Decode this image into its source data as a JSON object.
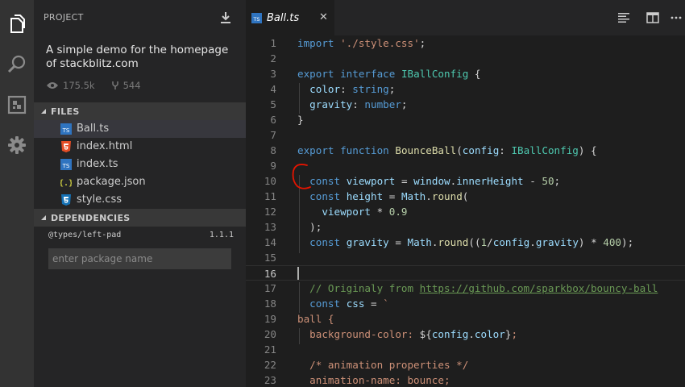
{
  "sidebar": {
    "title": "PROJECT",
    "description": "A simple demo for the homepage of stackblitz.com",
    "views": "175.5k",
    "forks": "544",
    "files_header": "FILES",
    "files": [
      {
        "name": "Ball.ts",
        "icon": "typescript-file-icon"
      },
      {
        "name": "index.html",
        "icon": "html5-file-icon"
      },
      {
        "name": "index.ts",
        "icon": "typescript-file-icon"
      },
      {
        "name": "package.json",
        "icon": "json-file-icon"
      },
      {
        "name": "style.css",
        "icon": "css3-file-icon"
      }
    ],
    "dependencies_header": "DEPENDENCIES",
    "dependency": {
      "name": "@types/left-pad",
      "version": "1.1.1"
    },
    "dependency_input_placeholder": "enter package name"
  },
  "tab": {
    "label": "Ball.ts",
    "close": "✕"
  },
  "colors": {
    "activity_bar": "#333333",
    "sidebar": "#252526",
    "editor": "#1e1e1e",
    "keyword": "#569cd6",
    "string": "#ce9178",
    "type": "#4ec9b0",
    "function": "#dcdcaa",
    "comment": "#6a9955",
    "annotation": "#e51400"
  },
  "editor": {
    "current_line": 16,
    "lines": [
      {
        "n": "1",
        "t": [
          [
            "kw",
            "import"
          ],
          [
            "pl",
            " "
          ],
          [
            "str",
            "'./style.css'"
          ],
          [
            "pl",
            ";"
          ]
        ]
      },
      {
        "n": "2",
        "t": []
      },
      {
        "n": "3",
        "t": [
          [
            "kw",
            "export"
          ],
          [
            "pl",
            " "
          ],
          [
            "kw",
            "interface"
          ],
          [
            "pl",
            " "
          ],
          [
            "ty",
            "IBallConfig"
          ],
          [
            "pl",
            " {"
          ]
        ]
      },
      {
        "n": "4",
        "t": [
          [
            "pl",
            "  "
          ],
          [
            "var",
            "color"
          ],
          [
            "pl",
            ": "
          ],
          [
            "kw",
            "string"
          ],
          [
            "pl",
            ";"
          ]
        ]
      },
      {
        "n": "5",
        "t": [
          [
            "pl",
            "  "
          ],
          [
            "var",
            "gravity"
          ],
          [
            "pl",
            ": "
          ],
          [
            "kw",
            "number"
          ],
          [
            "pl",
            ";"
          ]
        ]
      },
      {
        "n": "6",
        "t": [
          [
            "pl",
            "}"
          ]
        ]
      },
      {
        "n": "7",
        "t": []
      },
      {
        "n": "8",
        "t": [
          [
            "kw",
            "export"
          ],
          [
            "pl",
            " "
          ],
          [
            "kw",
            "function"
          ],
          [
            "pl",
            " "
          ],
          [
            "fn",
            "BounceBall"
          ],
          [
            "pl",
            "("
          ],
          [
            "var",
            "config"
          ],
          [
            "pl",
            ": "
          ],
          [
            "ty",
            "IBallConfig"
          ],
          [
            "pl",
            ") {"
          ]
        ]
      },
      {
        "n": "9",
        "t": []
      },
      {
        "n": "10",
        "t": [
          [
            "pl",
            "  "
          ],
          [
            "kw",
            "const"
          ],
          [
            "pl",
            " "
          ],
          [
            "var",
            "viewport"
          ],
          [
            "pl",
            " = "
          ],
          [
            "var",
            "window"
          ],
          [
            "pl",
            "."
          ],
          [
            "var",
            "innerHeight"
          ],
          [
            "pl",
            " - "
          ],
          [
            "num",
            "50"
          ],
          [
            "pl",
            ";"
          ]
        ]
      },
      {
        "n": "11",
        "t": [
          [
            "pl",
            "  "
          ],
          [
            "kw",
            "const"
          ],
          [
            "pl",
            " "
          ],
          [
            "var",
            "height"
          ],
          [
            "pl",
            " = "
          ],
          [
            "var",
            "Math"
          ],
          [
            "pl",
            "."
          ],
          [
            "fn",
            "round"
          ],
          [
            "pl",
            "("
          ]
        ]
      },
      {
        "n": "12",
        "t": [
          [
            "pl",
            "    "
          ],
          [
            "var",
            "viewport"
          ],
          [
            "pl",
            " * "
          ],
          [
            "num",
            "0.9"
          ]
        ]
      },
      {
        "n": "13",
        "t": [
          [
            "pl",
            "  );"
          ]
        ]
      },
      {
        "n": "14",
        "t": [
          [
            "pl",
            "  "
          ],
          [
            "kw",
            "const"
          ],
          [
            "pl",
            " "
          ],
          [
            "var",
            "gravity"
          ],
          [
            "pl",
            " = "
          ],
          [
            "var",
            "Math"
          ],
          [
            "pl",
            "."
          ],
          [
            "fn",
            "round"
          ],
          [
            "pl",
            "(("
          ],
          [
            "num",
            "1"
          ],
          [
            "pl",
            "/"
          ],
          [
            "var",
            "config"
          ],
          [
            "pl",
            "."
          ],
          [
            "var",
            "gravity"
          ],
          [
            "pl",
            ") * "
          ],
          [
            "num",
            "400"
          ],
          [
            "pl",
            ");"
          ]
        ]
      },
      {
        "n": "15",
        "t": []
      },
      {
        "n": "16",
        "t": []
      },
      {
        "n": "17",
        "t": [
          [
            "pl",
            "  "
          ],
          [
            "cm",
            "// Originaly from "
          ],
          [
            "lnk",
            "https://github.com/sparkbox/bouncy-ball"
          ]
        ]
      },
      {
        "n": "18",
        "t": [
          [
            "pl",
            "  "
          ],
          [
            "kw",
            "const"
          ],
          [
            "pl",
            " "
          ],
          [
            "var",
            "css"
          ],
          [
            "pl",
            " = "
          ],
          [
            "str",
            "`"
          ]
        ]
      },
      {
        "n": "19",
        "t": [
          [
            "str",
            "ball {"
          ]
        ]
      },
      {
        "n": "20",
        "t": [
          [
            "str",
            "  background-color: "
          ],
          [
            "pl",
            "${"
          ],
          [
            "var",
            "config"
          ],
          [
            "pl",
            "."
          ],
          [
            "var",
            "color"
          ],
          [
            "pl",
            "}"
          ],
          [
            "str",
            ";"
          ]
        ]
      },
      {
        "n": "21",
        "t": []
      },
      {
        "n": "22",
        "t": [
          [
            "str",
            "  /* animation properties */"
          ]
        ]
      },
      {
        "n": "23",
        "t": [
          [
            "str",
            "  animation-name: bounce;"
          ]
        ]
      }
    ]
  }
}
